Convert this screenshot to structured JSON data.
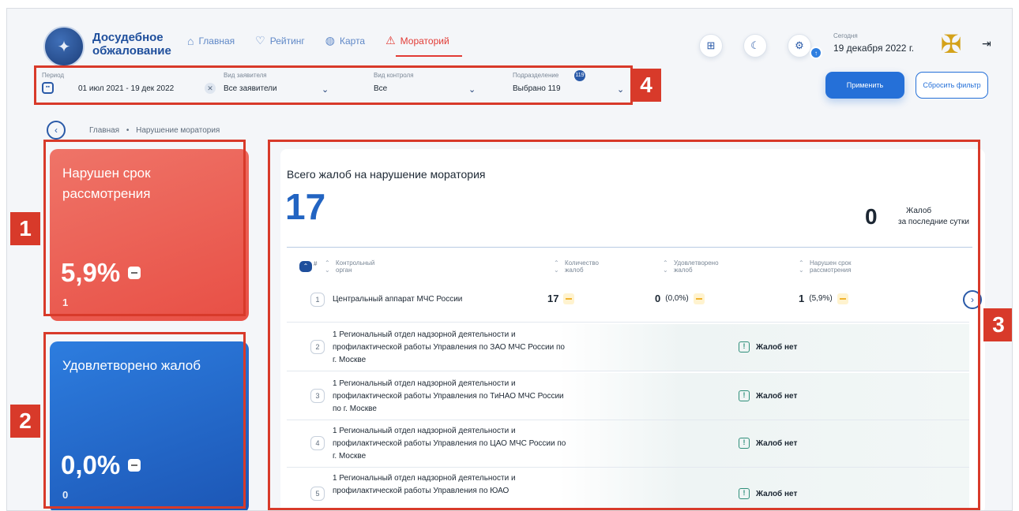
{
  "brand": {
    "name": "Досудебное обжалование"
  },
  "nav": [
    {
      "label": "Главная",
      "icon": "home-icon"
    },
    {
      "label": "Рейтинг",
      "icon": "trophy-icon"
    },
    {
      "label": "Карта",
      "icon": "globe-icon"
    },
    {
      "label": "Мораторий",
      "icon": "warning-icon",
      "active": true
    }
  ],
  "header": {
    "today_label": "Сегодня",
    "today_date": "19 декабря 2022 г."
  },
  "filters": {
    "period": {
      "label": "Период",
      "value": "01 июл 2021  -  19 дек 2022"
    },
    "applicant": {
      "label": "Вид заявителя",
      "value": "Все заявители"
    },
    "control": {
      "label": "Вид контроля",
      "value": "Все"
    },
    "division": {
      "label": "Подразделение",
      "badge": "119",
      "value": "Выбрано 119"
    }
  },
  "actions": {
    "apply": "Применить",
    "reset": "Сбросить фильтр"
  },
  "breadcrumb": {
    "home": "Главная",
    "separator": "•",
    "current": "Нарушение моратория"
  },
  "cards": {
    "overdue": {
      "title": "Нарушен срок рассмотрения",
      "percent": "5,9%",
      "count": "1"
    },
    "satisfied": {
      "title": "Удовлетворено жалоб",
      "percent": "0,0%",
      "count": "0"
    }
  },
  "panel": {
    "title": "Всего жалоб на нарушение моратория",
    "total": "17",
    "day_count": "0",
    "day_label_1": "Жалоб",
    "day_label_2": "за последние сутки"
  },
  "table": {
    "hash": "#",
    "columns": {
      "organ_1": "Контрольный",
      "organ_2": "орган",
      "count_1": "Количество",
      "count_2": "жалоб",
      "satisfied_1": "Удовлетворено",
      "satisfied_2": "жалоб",
      "overdue_1": "Нарушен срок",
      "overdue_2": "рассмотрения"
    },
    "first_row": {
      "index": "1",
      "name": "Центральный аппарат МЧС России",
      "count": "17",
      "satisfied": "0",
      "satisfied_pct": "(0,0%)",
      "overdue": "1",
      "overdue_pct": "(5,9%)"
    },
    "rows": [
      {
        "index": "2",
        "name": "1 Региональный отдел надзорной деятельности и профилактической работы Управления по ЗАО МЧС России по г. Москве",
        "status": "Жалоб нет"
      },
      {
        "index": "3",
        "name": "1 Региональный отдел надзорной деятельности и профилактической работы Управления по ТиНАО МЧС России по г. Москве",
        "status": "Жалоб нет"
      },
      {
        "index": "4",
        "name": "1 Региональный отдел надзорной деятельности и профилактической работы Управления по ЦАО МЧС России по г. Москве",
        "status": "Жалоб нет"
      },
      {
        "index": "5",
        "name": "1 Региональный отдел надзорной деятельности и профилактической работы Управления по ЮАО",
        "status": "Жалоб нет"
      }
    ]
  },
  "annotations": {
    "tag1": "1",
    "tag2": "2",
    "tag3": "3",
    "tag4": "4"
  },
  "colors": {
    "accent": "#2570d8",
    "alert": "#e23b35",
    "annotation": "#d83a2a",
    "card_red": "#e8574c",
    "card_blue": "#2264c2"
  }
}
